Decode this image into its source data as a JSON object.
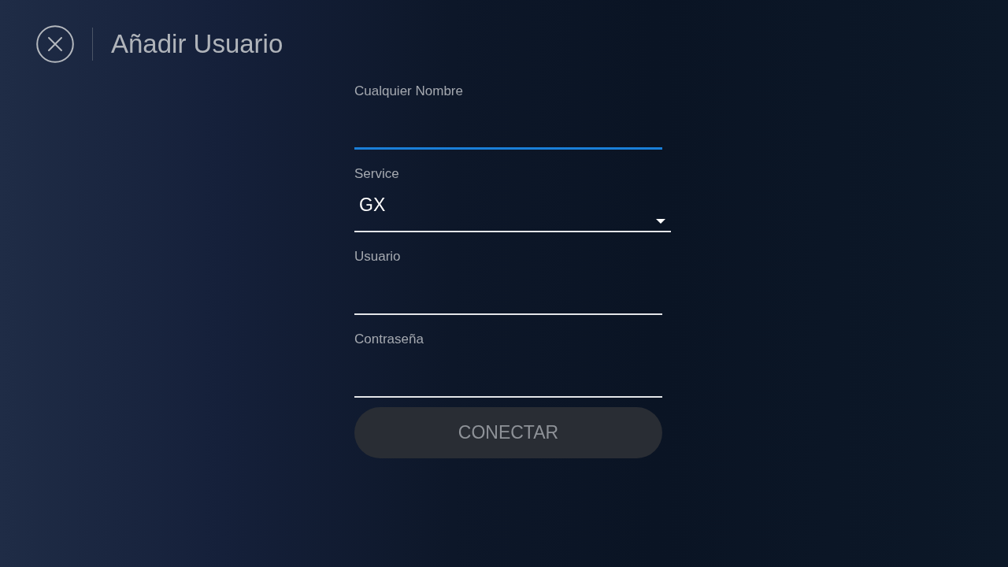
{
  "header": {
    "title": "Añadir Usuario"
  },
  "fields": [
    {
      "kind": "text",
      "label": "Cualquier Nombre",
      "focused": true
    },
    {
      "kind": "select",
      "label": "Service",
      "value": "GX"
    },
    {
      "kind": "text",
      "label": "Usuario",
      "focused": false
    },
    {
      "kind": "password",
      "label": "Contraseña",
      "focused": false
    }
  ],
  "connect_button": {
    "label": "CONECTAR",
    "disabled": true
  }
}
